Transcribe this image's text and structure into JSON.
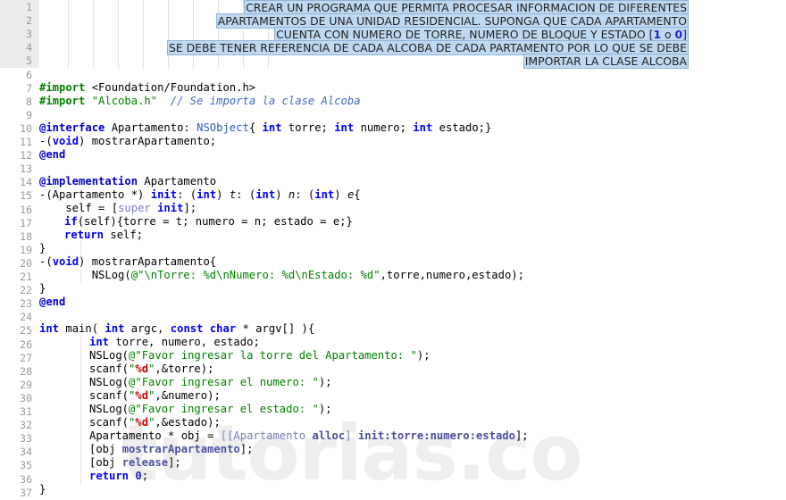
{
  "editor": {
    "title": "Objective-C source editor",
    "watermark": "tutorias.co",
    "total_lines": 37,
    "first_line": 1,
    "highlighted_lines": [
      1,
      2,
      3,
      4,
      5
    ],
    "colors": {
      "background": "#ffffff",
      "gutter_background": "#ececec",
      "gutter_text": "#999999",
      "selection": "#bfd9f2",
      "selection_border": "#8fb4d9",
      "keyword": "#0000ff",
      "preprocessor": "#008000",
      "string": "#008000",
      "comment": "#4169c8",
      "type": "#2b5fb8",
      "number": "#2222cc",
      "format_specifier": "#cc0000",
      "message_send": "#7a7fb5",
      "watermark": "#eeeeee"
    }
  },
  "line_numbers": [
    "1",
    "2",
    "3",
    "4",
    "5",
    "6",
    "7",
    "8",
    "9",
    "10",
    "11",
    "12",
    "13",
    "14",
    "15",
    "16",
    "17",
    "18",
    "19",
    "20",
    "21",
    "22",
    "23",
    "24",
    "25",
    "26",
    "27",
    "28",
    "29",
    "30",
    "31",
    "32",
    "33",
    "34",
    "35",
    "36",
    "37"
  ],
  "problem_statement": {
    "line_1": "CREAR UN PROGRAMA QUE PERMITA PROCESAR INFORMACION DE DIFERENTES",
    "line_2": "APARTAMENTOS DE UNA UNIDAD RESIDENCIAL. SUPONGA QUE CADA APARTAMENTO",
    "line_3_a": "CUENTA CON NUMERO DE TORRE, NUMERO DE BLOQUE Y ESTADO [",
    "line_3_num1": "1",
    "line_3_mid": " o ",
    "line_3_num2": "0",
    "line_3_b": "]",
    "line_4": "SE DEBE TENER REFERENCIA DE CADA ALCOBA DE CADA PARTAMENTO POR LO QUE SE DEBE",
    "line_5": "IMPORTAR LA CLASE ALCOBA"
  },
  "code": {
    "l7": {
      "pre": "#import",
      "rest": " <Foundation/Foundation.h>"
    },
    "l8": {
      "pre": "#import",
      "str": " \"Alcoba.h\"",
      "gap": "  ",
      "cmt": "// Se importa la clase Alcoba"
    },
    "l10": {
      "at": "@interface",
      "a": " Apartamento: ",
      "type": "NSObject",
      "b": "{ ",
      "k1": "int",
      "c": " torre; ",
      "k2": "int",
      "d": " numero; ",
      "k3": "int",
      "e": " estado;}"
    },
    "l11": {
      "a": "-(",
      "kw": "void",
      "b": ") mostrarApartamento;"
    },
    "l12": {
      "at": "@end"
    },
    "l14": {
      "at": "@implementation",
      "rest": " Apartamento"
    },
    "l15": {
      "a": "-(Apartamento *) ",
      "init": "init",
      "b": ": (",
      "k1": "int",
      "c": ") ",
      "p1": "t",
      "d": ": (",
      "k2": "int",
      "e": ") ",
      "p2": "n",
      "f": ": (",
      "k3": "int",
      "g": ") ",
      "p3": "e",
      "h": "{"
    },
    "l16": {
      "a": "    self = [",
      "sup": "super",
      "b": " ",
      "init": "init",
      "c": "];"
    },
    "l17": {
      "kw": "if",
      "rest": "(self){torre = t; numero = n; estado = e;}"
    },
    "l18": {
      "kw": "return",
      "rest": " self;"
    },
    "l19": {
      "text": "}"
    },
    "l20": {
      "a": "-(",
      "kw": "void",
      "b": ") mostrarApartamento{"
    },
    "l21": {
      "a": "        NSLog(",
      "str": "@\"\\nTorre: %d\\nNumero: %d\\nEstado: %d\"",
      "b": ",torre,numero,estado);"
    },
    "l22": {
      "text": "}"
    },
    "l23": {
      "at": "@end"
    },
    "l25": {
      "k1": "int",
      "a": " main( ",
      "k2": "int",
      "b": " argc, ",
      "k3": "const",
      "c": " ",
      "k4": "char",
      "d": " * argv[] ){"
    },
    "l26": {
      "kw": "int",
      "rest": " torre, numero, estado;"
    },
    "l27": {
      "a": "NSLog(",
      "str": "@\"Favor ingresar la torre del Apartamento: \"",
      "b": ");"
    },
    "l28": {
      "a": "scanf(",
      "q1": "\"",
      "fmt": "%d",
      "q2": "\"",
      "b": ",&torre);"
    },
    "l29": {
      "a": "NSLog(",
      "str": "@\"Favor ingresar el numero: \"",
      "b": ");"
    },
    "l30": {
      "a": "scanf(",
      "q1": "\"",
      "fmt": "%d",
      "q2": "\"",
      "b": ",&numero);"
    },
    "l31": {
      "a": "NSLog(",
      "str": "@\"Favor ingresar el estado: \"",
      "b": ");"
    },
    "l32": {
      "a": "scanf(",
      "q1": "\"",
      "fmt": "%d",
      "q2": "\"",
      "b": ",&estado);"
    },
    "l33": {
      "a": "Apartamento * obj = ",
      "msg": "[[Apartamento ",
      "alloc": "alloc",
      "b": "] ",
      "init": "init:torre:numero:estado",
      "c": "];"
    },
    "l34": {
      "a": "[obj ",
      "m": "mostrarApartamento",
      "b": "];"
    },
    "l35": {
      "a": "[obj ",
      "m": "release",
      "b": "];"
    },
    "l36": {
      "kw": "return",
      "sp": " ",
      "num": "0",
      "b": ";"
    },
    "l37": {
      "text": "}"
    }
  }
}
